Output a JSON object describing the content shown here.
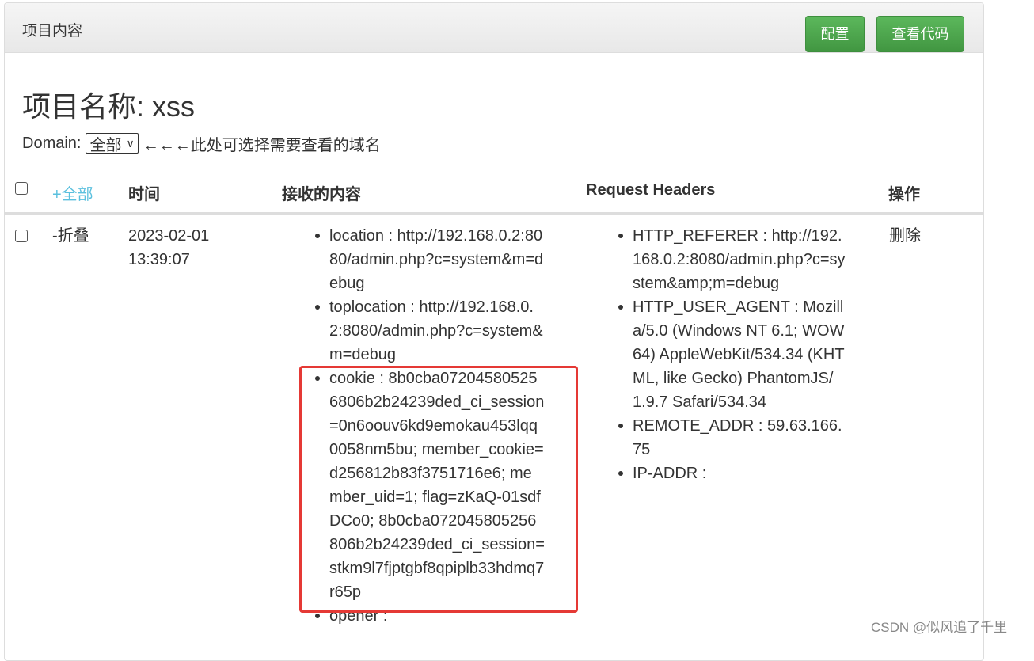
{
  "header": {
    "title": "项目内容",
    "config_label": "配置",
    "view_code_label": "查看代码"
  },
  "project": {
    "title": "项目名称: xss"
  },
  "domain": {
    "label": "Domain:",
    "selected": "全部",
    "hint": "←←←此处可选择需要查看的域名"
  },
  "table": {
    "columns": {
      "expand_all": "+全部",
      "time": "时间",
      "content": "接收的内容",
      "headers": "Request Headers",
      "actions": "操作"
    },
    "rows": [
      {
        "toggle": "-折叠",
        "date": "2023-02-01",
        "time": "13:39:07",
        "content": [
          "location : http://192.168.0.2:8080/admin.php?c=system&m=debug",
          "toplocation : http://192.168.0.2:8080/admin.php?c=system&m=debug",
          "cookie : 8b0cba072045805256806b2b24239ded_ci_session=0n6oouv6kd9emokau453lqq0058nm5bu; member_cookie=d256812b83f3751716e6; member_uid=1; flag=zKaQ-01sdfDCo0; 8b0cba072045805256806b2b24239ded_ci_session=stkm9l7fjptgbf8qpiplb33hdmq7r65p",
          "opener :"
        ],
        "headers": [
          "HTTP_REFERER : http://192.168.0.2:8080/admin.php?c=system&amp;m=debug",
          "HTTP_USER_AGENT : Mozilla/5.0 (Windows NT 6.1; WOW64) AppleWebKit/534.34 (KHTML, like Gecko) PhantomJS/1.9.7 Safari/534.34",
          "REMOTE_ADDR : 59.63.166.75",
          "IP-ADDR :"
        ],
        "action": "删除"
      }
    ]
  },
  "watermark": "CSDN @似风追了千里",
  "colors": {
    "button_green": "#4cae4c",
    "link_blue": "#5bc0de",
    "highlight_red": "#e53935"
  }
}
